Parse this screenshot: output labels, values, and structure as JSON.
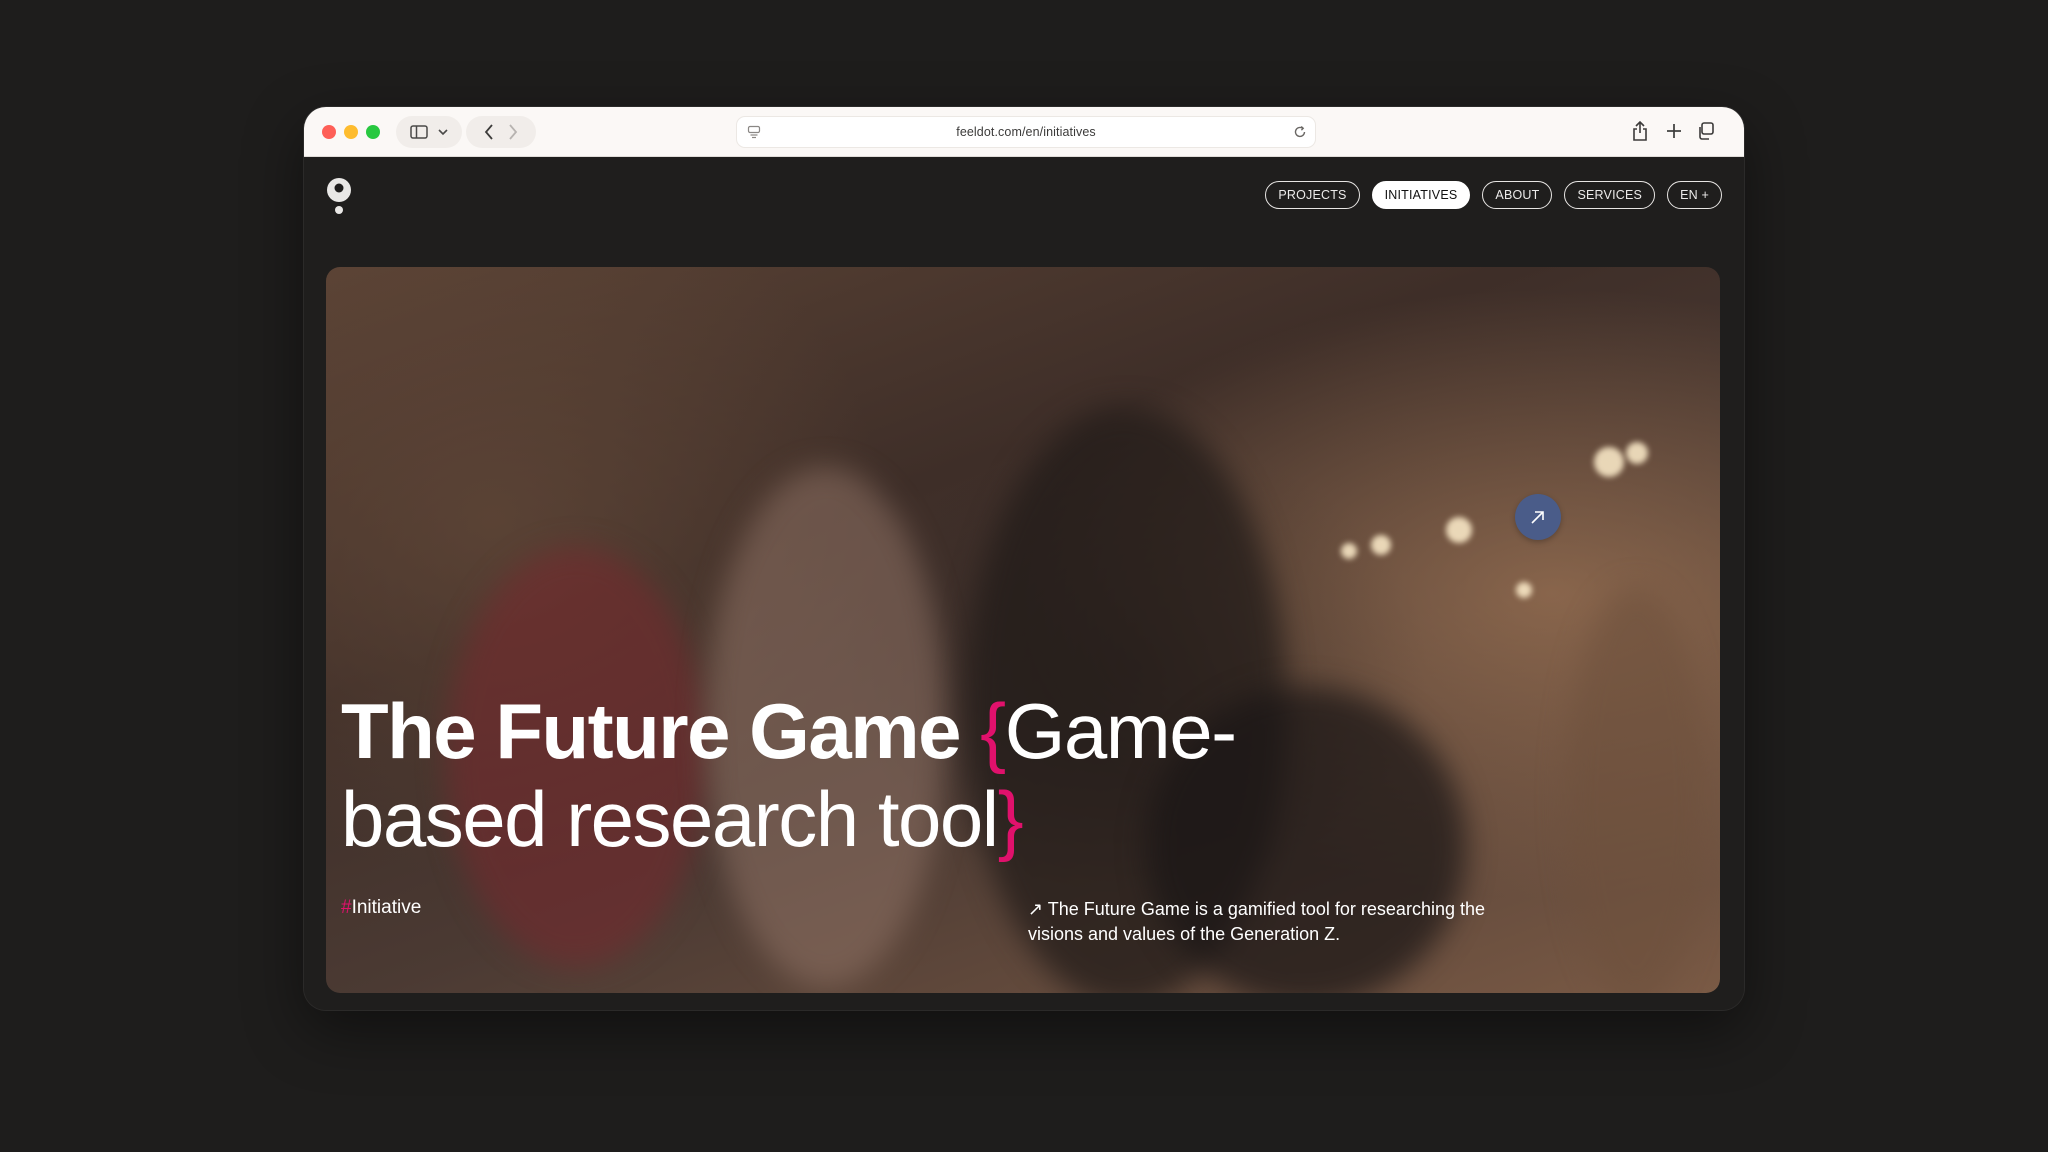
{
  "browser": {
    "url": "feeldot.com/en/initiatives"
  },
  "nav": {
    "items": [
      {
        "label": "PROJECTS",
        "active": false
      },
      {
        "label": "INITIATIVES",
        "active": true
      },
      {
        "label": "ABOUT",
        "active": false
      },
      {
        "label": "SERVICES",
        "active": false
      },
      {
        "label": "EN +",
        "active": false
      }
    ]
  },
  "hero": {
    "title_strong": "The Future Game",
    "brace_open": "{",
    "title_light_1": "Game-",
    "title_light_2": "based research tool",
    "brace_close": "}",
    "tag_hash": "#",
    "tag_label": "Initiative",
    "description_arrow": "↗",
    "description": "The Future Game is a gamified tool for researching the visions and values of the Generation Z."
  },
  "colors": {
    "accent": "#e0116c",
    "background": "#1f1e1d",
    "link_button": "#4a5c89"
  },
  "icons": {
    "logo": "feeldot-pin-logo",
    "hero_link": "arrow-up-right-icon"
  }
}
